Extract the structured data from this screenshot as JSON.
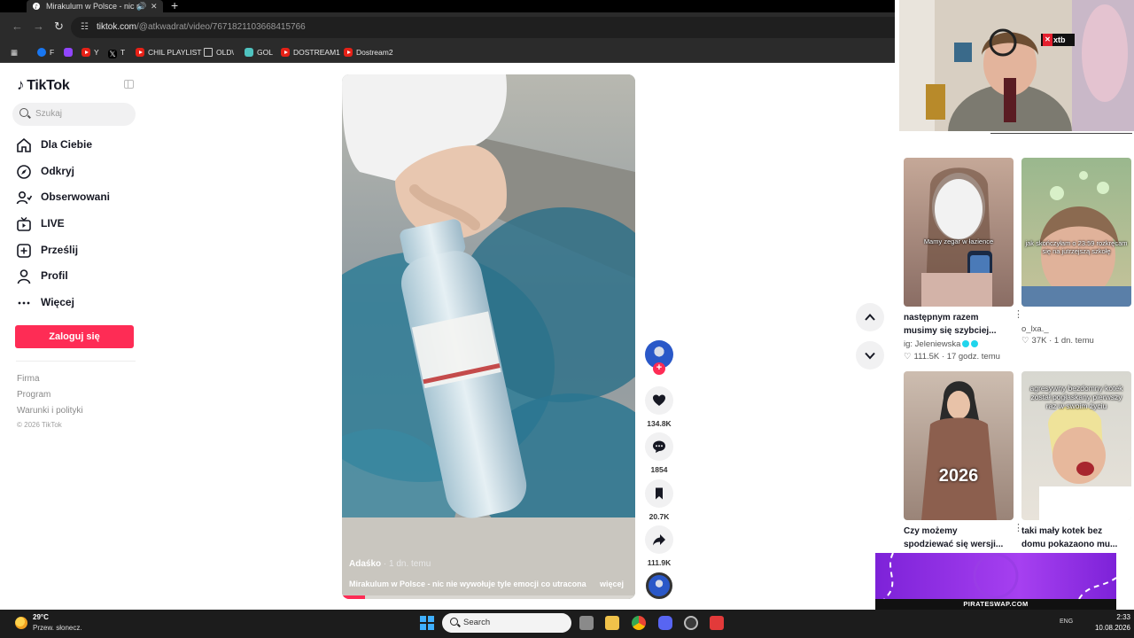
{
  "browser": {
    "tab_title": "Mirakulum w Polsce - nic n",
    "url_host": "tiktok.com",
    "url_path": "/@atkwadrat/video/7671821103668415766",
    "bookmarks": [
      {
        "label": "F",
        "icon": "facebook-icon",
        "color": "#1877f2"
      },
      {
        "label": "",
        "icon": "twitch-icon",
        "color": "#9146ff"
      },
      {
        "label": "Y",
        "icon": "youtube-icon",
        "color": "#e62117"
      },
      {
        "label": "T",
        "icon": "x-icon",
        "color": "#000000"
      },
      {
        "label": "CHIL PLAYLIST",
        "icon": "youtube-icon",
        "color": "#e62117"
      },
      {
        "label": "OLD\\",
        "icon": "folder-icon",
        "color": "#cccccc"
      },
      {
        "label": "GOL",
        "icon": "gol-icon",
        "color": "#4fc3c0"
      },
      {
        "label": "DOSTREAM1",
        "icon": "youtube-icon",
        "color": "#e62117"
      },
      {
        "label": "Dostream2",
        "icon": "youtube-icon",
        "color": "#e62117"
      }
    ]
  },
  "sidebar": {
    "logo": "TikTok",
    "search_placeholder": "Szukaj",
    "nav": [
      {
        "label": "Dla Ciebie",
        "icon": "home-icon"
      },
      {
        "label": "Odkryj",
        "icon": "compass-icon"
      },
      {
        "label": "Obserwowani",
        "icon": "following-icon"
      },
      {
        "label": "LIVE",
        "icon": "live-icon"
      },
      {
        "label": "Prześlij",
        "icon": "upload-icon"
      },
      {
        "label": "Profil",
        "icon": "profile-icon"
      },
      {
        "label": "Więcej",
        "icon": "more-icon"
      }
    ],
    "login_label": "Zaloguj się",
    "footer": [
      "Firma",
      "Program",
      "Warunki i polityki"
    ],
    "copyright": "© 2026 TikTok"
  },
  "video": {
    "author": "Adaśko",
    "age": " · 1 dn. temu",
    "caption": "Mirakulum w Polsce - nic nie wywołuje tyle emocji co utracona",
    "more_label": "więcej",
    "progress": 0.08,
    "likes": "134.8K",
    "comments": "1854",
    "saves": "20.7K",
    "shares": "111.9K",
    "accent": "#fe2c55"
  },
  "feed": [
    {
      "title": "następnym razem musimy się szybciej...",
      "author": "ig: Jeleniewska",
      "likes": "111.5K",
      "age": "17 godz. temu",
      "overlay": "Mamy zegar w łazience"
    },
    {
      "title": "",
      "author": "o_lxa._",
      "likes": "37K",
      "age": "1 dn. temu",
      "overlay": "jak skończyłam o 23:59 rozkręcam się na jutrzejszą szkołę"
    },
    {
      "title": "Czy możemy spodziewać się wersji...",
      "author": "",
      "likes": "",
      "age": "",
      "overlay": "2026"
    },
    {
      "title": "taki mały kotek bez domu pokazaono mu...",
      "author": "",
      "likes": "",
      "age": "",
      "overlay": "agresywny bezdomny kotek został pogłaskany pierwszy raz w swoim życiu"
    }
  ],
  "stream": {
    "sponsor": "xtb",
    "promo": "PIRATESWAP.COM"
  },
  "taskbar": {
    "temp": "29°C",
    "weather": "Przew. słonecz.",
    "search_label": "Search",
    "time": "2:33",
    "date": "10.08.2026",
    "lang": "ENG"
  }
}
